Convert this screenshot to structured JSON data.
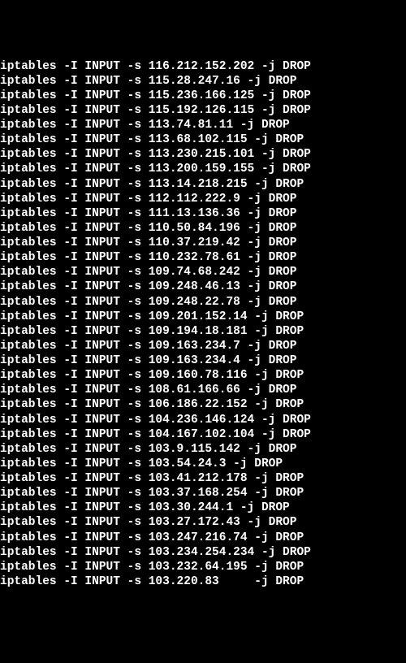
{
  "terminal": {
    "lines": [
      "iptables -I INPUT -s 116.212.152.202 -j DROP",
      "iptables -I INPUT -s 115.28.247.16 -j DROP",
      "iptables -I INPUT -s 115.236.166.125 -j DROP",
      "iptables -I INPUT -s 115.192.126.115 -j DROP",
      "iptables -I INPUT -s 113.74.81.11 -j DROP",
      "iptables -I INPUT -s 113.68.102.115 -j DROP",
      "iptables -I INPUT -s 113.230.215.101 -j DROP",
      "iptables -I INPUT -s 113.200.159.155 -j DROP",
      "iptables -I INPUT -s 113.14.218.215 -j DROP",
      "iptables -I INPUT -s 112.112.222.9 -j DROP",
      "iptables -I INPUT -s 111.13.136.36 -j DROP",
      "iptables -I INPUT -s 110.50.84.196 -j DROP",
      "iptables -I INPUT -s 110.37.219.42 -j DROP",
      "iptables -I INPUT -s 110.232.78.61 -j DROP",
      "iptables -I INPUT -s 109.74.68.242 -j DROP",
      "iptables -I INPUT -s 109.248.46.13 -j DROP",
      "iptables -I INPUT -s 109.248.22.78 -j DROP",
      "iptables -I INPUT -s 109.201.152.14 -j DROP",
      "iptables -I INPUT -s 109.194.18.181 -j DROP",
      "iptables -I INPUT -s 109.163.234.7 -j DROP",
      "iptables -I INPUT -s 109.163.234.4 -j DROP",
      "iptables -I INPUT -s 109.160.78.116 -j DROP",
      "iptables -I INPUT -s 108.61.166.66 -j DROP",
      "iptables -I INPUT -s 106.186.22.152 -j DROP",
      "iptables -I INPUT -s 104.236.146.124 -j DROP",
      "iptables -I INPUT -s 104.167.102.104 -j DROP",
      "iptables -I INPUT -s 103.9.115.142 -j DROP",
      "iptables -I INPUT -s 103.54.24.3 -j DROP",
      "iptables -I INPUT -s 103.41.212.178 -j DROP",
      "iptables -I INPUT -s 103.37.168.254 -j DROP",
      "iptables -I INPUT -s 103.30.244.1 -j DROP",
      "iptables -I INPUT -s 103.27.172.43 -j DROP",
      "iptables -I INPUT -s 103.247.216.74 -j DROP",
      "iptables -I INPUT -s 103.234.254.234 -j DROP",
      "iptables -I INPUT -s 103.232.64.195 -j DROP",
      "iptables -I INPUT -s 103.220.83     -j DROP"
    ]
  }
}
